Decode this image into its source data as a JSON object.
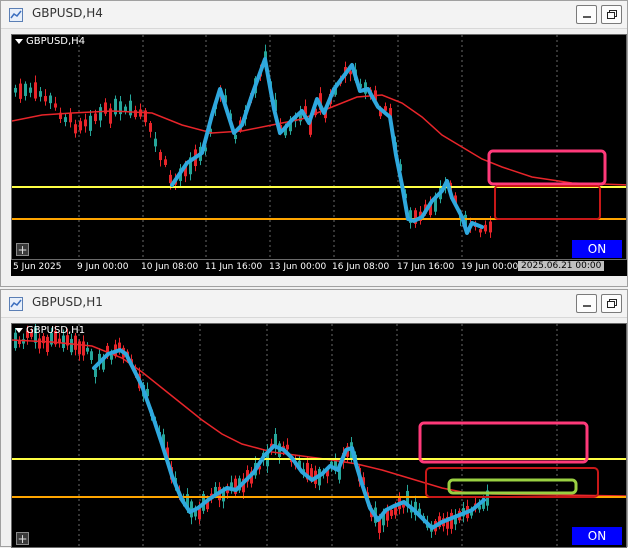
{
  "colors": {
    "background": "#000000",
    "bull_candle": "#26a69a",
    "bear_candle": "#e8252a",
    "moving_average": "#e8252a",
    "trendline": "#2fa8de",
    "level_yellow": "#ffff44",
    "level_orange": "#ffa500",
    "zone_pink": "#ff3a7a",
    "zone_red": "#c81818",
    "zone_green": "#9ad042",
    "on_button": "#0000ff"
  },
  "window_h4": {
    "title": "GBPUSD,H4",
    "symbol_label": "GBPUSD,H4",
    "on_label": "ON",
    "plus_label": "+",
    "icons": [
      "chart-app-icon",
      "minimize-icon",
      "restore-icon"
    ],
    "x_axis": [
      "5 Jun 2025",
      "9 Jun 00:00",
      "10 Jun 08:00",
      "11 Jun 16:00",
      "13 Jun 00:00",
      "16 Jun 08:00",
      "17 Jun 16:00",
      "19 Jun 00:00"
    ],
    "cursor_date": "2025.06.21 00:00"
  },
  "window_h1": {
    "title": "GBPUSD,H1",
    "symbol_label": "GBPUSD,H1",
    "on_label": "ON",
    "plus_label": "+",
    "icons": [
      "chart-app-icon",
      "minimize-icon",
      "restore-icon"
    ]
  }
}
